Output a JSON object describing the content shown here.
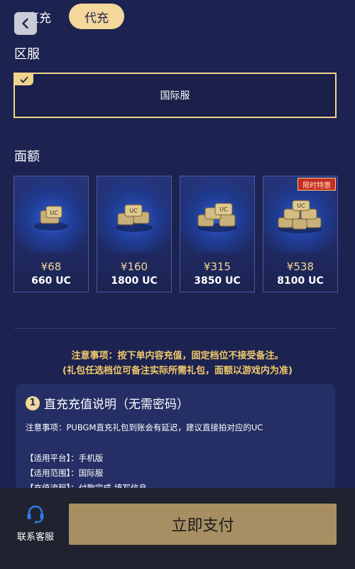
{
  "tabs": {
    "direct_label": "直充",
    "proxy_label": "代充"
  },
  "region": {
    "section_label": "区服",
    "selected": "国际服"
  },
  "amount": {
    "section_label": "面额",
    "cards": [
      {
        "price": "¥68",
        "uc": "660 UC"
      },
      {
        "price": "¥160",
        "uc": "1800 UC"
      },
      {
        "price": "¥315",
        "uc": "3850 UC"
      },
      {
        "price": "¥538",
        "uc": "8100 UC",
        "badge": "限时特惠"
      }
    ]
  },
  "notice": {
    "line1": "注意事项：按下单内容充值，固定档位不接受备注。",
    "line2": "(礼包任选档位可备注实际所需礼包，面额以游戏内为准)"
  },
  "info": {
    "number": "1",
    "title": "直充充值说明（无需密码）",
    "note": "注意事项：PUBGM直充礼包到账会有延迟，建议直接拍对应的UC",
    "lines": [
      "【适用平台】：手机版",
      "【适用范围】：国际服",
      "【充值流程】：付款完成-填写信息"
    ]
  },
  "bottom": {
    "service_label": "联系客服",
    "pay_label": "立即支付"
  },
  "colors": {
    "accent": "#f4d79a",
    "background": "#1c2350",
    "pay_button": "#a88f63"
  },
  "icons": {
    "back": "chevron-left-icon",
    "check": "check-icon",
    "service": "headset-icon",
    "uc": "uc-coins-icon"
  }
}
